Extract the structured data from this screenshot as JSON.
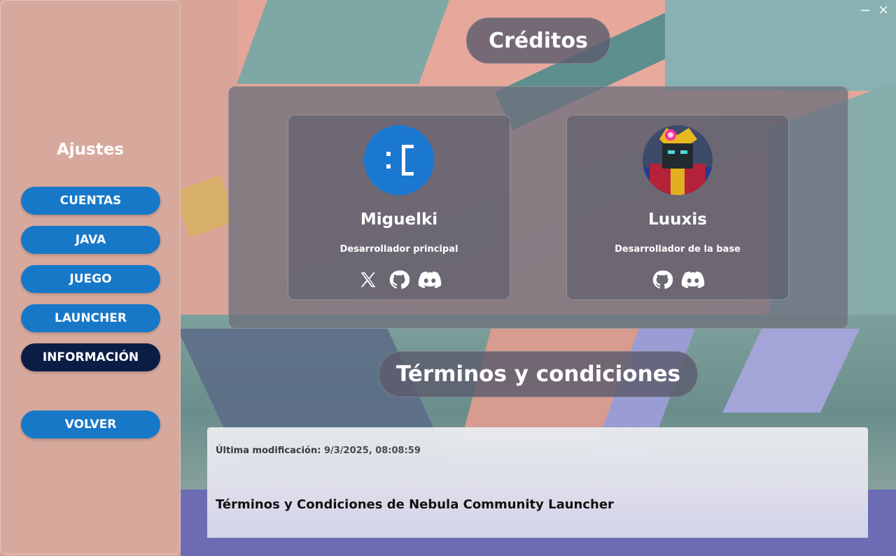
{
  "window": {
    "minimize_label": "—",
    "close_label": "✕"
  },
  "sidebar": {
    "title": "Ajustes",
    "items": [
      {
        "label": "CUENTAS"
      },
      {
        "label": "JAVA"
      },
      {
        "label": "JUEGO"
      },
      {
        "label": "LAUNCHER"
      },
      {
        "label": "INFORMACIÓN",
        "active": true
      }
    ],
    "back_label": "VOLVER"
  },
  "credits": {
    "title": "Créditos",
    "people": [
      {
        "name": "Miguelki",
        "role": "Desarrollador principal",
        "avatar_text": ":(",
        "socials": [
          "x-icon",
          "github-icon",
          "discord-icon"
        ]
      },
      {
        "name": "Luuxis",
        "role": "Desarrollador de la base",
        "socials": [
          "github-icon",
          "discord-icon"
        ]
      }
    ]
  },
  "terms": {
    "title": "Términos y condiciones",
    "updated_label": "Última modificación:",
    "updated_value": "9/3/2025, 08:08:59",
    "heading": "Términos y Condiciones de Nebula Community Launcher"
  },
  "colors": {
    "nav_button": "#1878c8",
    "nav_button_active": "#0c1d45",
    "avatar_blue": "#1b78d0"
  }
}
